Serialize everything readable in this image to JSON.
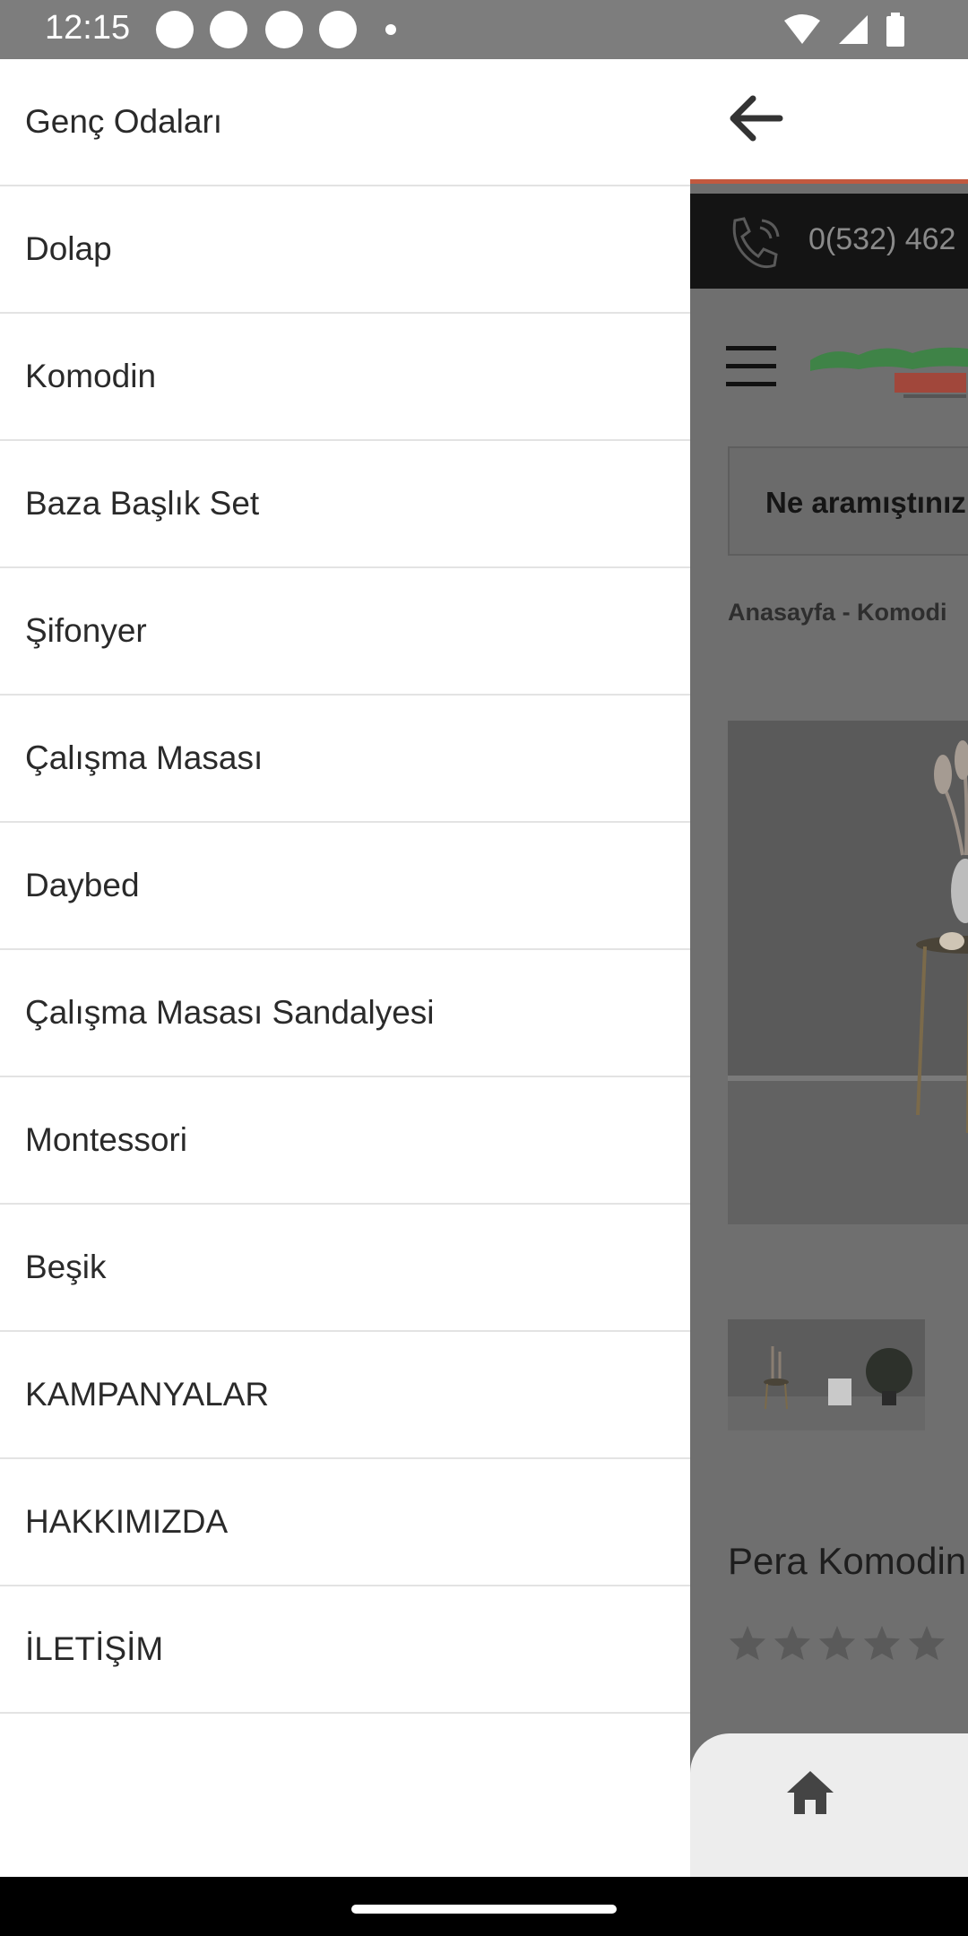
{
  "status_bar": {
    "time": "12:15",
    "icons": [
      "notification-icon",
      "notification-icon",
      "notification-icon",
      "notification-icon",
      "more-dot-icon",
      "wifi-icon",
      "signal-icon",
      "battery-icon"
    ]
  },
  "drawer": {
    "items": [
      {
        "label": "Genç Odaları"
      },
      {
        "label": "Dolap"
      },
      {
        "label": "Komodin"
      },
      {
        "label": "Baza Başlık Set"
      },
      {
        "label": "Şifonyer"
      },
      {
        "label": "Çalışma Masası"
      },
      {
        "label": "Daybed"
      },
      {
        "label": "Çalışma Masası Sandalyesi"
      },
      {
        "label": "Montessori"
      },
      {
        "label": "Beşik"
      },
      {
        "label": "KAMPANYALAR"
      },
      {
        "label": "HAKKIMIZDA"
      },
      {
        "label": "İLETİŞİM"
      }
    ]
  },
  "webpage": {
    "phone": "0(532) 462",
    "search_placeholder": "Ne aramıştınız",
    "breadcrumb": "Anasayfa  -  Komodi",
    "product_title": "Pera Komodin",
    "rating_stars": 5,
    "colors": {
      "accent": "#c2593f",
      "logo_green": "#2f8a3a",
      "logo_red": "#b23a2a"
    }
  }
}
